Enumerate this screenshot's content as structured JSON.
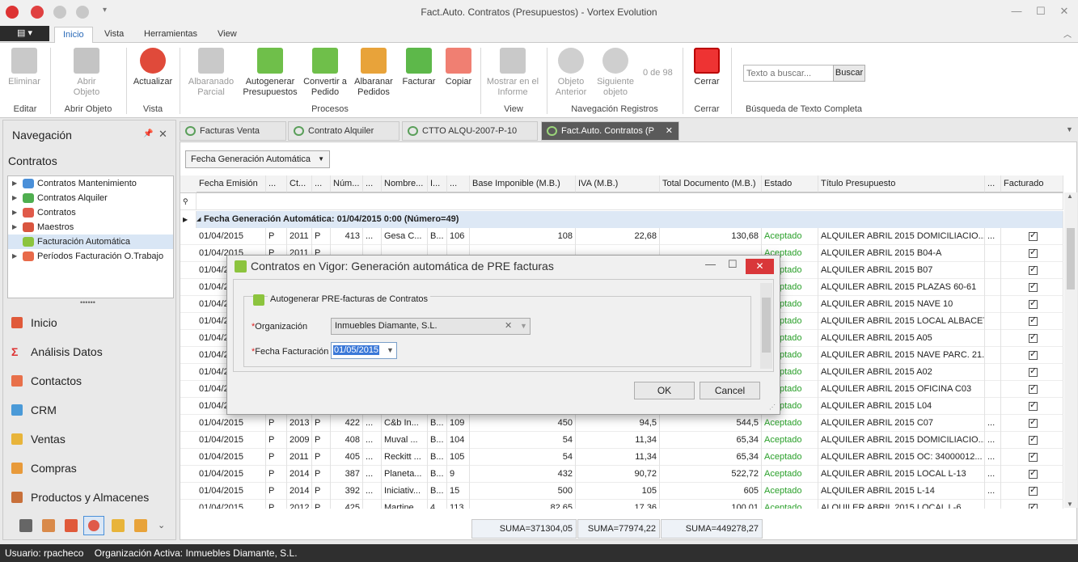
{
  "window": {
    "title": "Fact.Auto. Contratos (Presupuestos) - Vortex Evolution"
  },
  "ribbon_tabs": [
    "Inicio",
    "Vista",
    "Herramientas",
    "View"
  ],
  "ribbon": {
    "eliminar": "Eliminar",
    "abrir_objeto": "Abrir Objeto",
    "actualizar": "Actualizar",
    "albaranado_parcial": "Albaranado Parcial",
    "autogenerar": "Autogenerar Presupuestos",
    "convertir": "Convertir a Pedido",
    "albaranar": "Albaranar Pedidos",
    "facturar": "Facturar",
    "copiar": "Copiar",
    "mostrar": "Mostrar en el Informe",
    "anterior": "Objeto Anterior",
    "siguiente": "Siguiente objeto",
    "counter": "0 de 98",
    "cerrar": "Cerrar",
    "search_placeholder": "Texto a buscar...",
    "buscar": "Buscar",
    "groups": [
      "Editar",
      "Abrir Objeto",
      "Vista",
      "Procesos",
      "View",
      "Navegación Registros",
      "Cerrar",
      "Búsqueda de Texto Completa"
    ]
  },
  "navigation": {
    "title": "Navegación",
    "section": "Contratos",
    "tree": [
      "Contratos Mantenimiento",
      "Contratos Alquiler",
      "Contratos",
      "Maestros",
      "Facturación Automática",
      "Períodos Facturación O.Trabajo"
    ],
    "buttons": [
      "Inicio",
      "Análisis Datos",
      "Contactos",
      "CRM",
      "Ventas",
      "Compras",
      "Productos y Almacenes"
    ]
  },
  "doc_tabs": [
    "Facturas Venta",
    "Contrato Alquiler",
    "CTTO ALQU-2007-P-10",
    "Fact.Auto. Contratos (P"
  ],
  "grid": {
    "group_by": "Fecha Generación Automática",
    "columns": [
      "Fecha Emisión",
      "...",
      "Ct...",
      "...",
      "Núm...",
      "...",
      "Nombre...",
      "I...",
      "...",
      "Base Imponible (M.B.)",
      "IVA (M.B.)",
      "Total Documento (M.B.)",
      "Estado",
      "Título Presupuesto",
      "...",
      "Facturado"
    ],
    "group_row": "Fecha Generación Automática: 01/04/2015 0:00 (Número=49)",
    "rows": [
      [
        "01/04/2015",
        "P",
        "2011",
        "P",
        "413",
        "...",
        "Gesa C...",
        "B...",
        "106",
        "108",
        "22,68",
        "130,68",
        "Aceptado",
        "ALQUILER ABRIL 2015 DOMICILIACIO...",
        "..."
      ],
      [
        "01/04/2015",
        "P",
        "2011",
        "P",
        "",
        "",
        "",
        "",
        "",
        "",
        "",
        "",
        "Aceptado",
        "ALQUILER ABRIL 2015 B04-A",
        ""
      ],
      [
        "01/04/2015",
        "",
        "",
        "",
        "",
        "",
        "",
        "",
        "",
        "",
        "",
        "",
        "Aceptado",
        "ALQUILER ABRIL 2015 B07",
        ""
      ],
      [
        "01/04/2015",
        "",
        "",
        "",
        "",
        "",
        "",
        "",
        "",
        "",
        "",
        "",
        "Aceptado",
        "ALQUILER ABRIL 2015 PLAZAS 60-61",
        ""
      ],
      [
        "01/04/2015",
        "",
        "",
        "",
        "",
        "",
        "",
        "",
        "",
        "",
        "",
        "",
        "Aceptado",
        "ALQUILER ABRIL 2015 NAVE 10",
        ""
      ],
      [
        "01/04/2015",
        "",
        "",
        "",
        "",
        "",
        "",
        "",
        "",
        "",
        "",
        "",
        "Aceptado",
        "ALQUILER ABRIL 2015 LOCAL ALBACETE",
        ""
      ],
      [
        "01/04/2015",
        "",
        "",
        "",
        "",
        "",
        "",
        "",
        "",
        "",
        "",
        "",
        "Aceptado",
        "ALQUILER ABRIL 2015 A05",
        ""
      ],
      [
        "01/04/2015",
        "",
        "",
        "",
        "",
        "",
        "",
        "",
        "",
        "",
        "",
        "",
        "Aceptado",
        "ALQUILER ABRIL 2015 NAVE PARC. 21...",
        ""
      ],
      [
        "01/04/2015",
        "",
        "",
        "",
        "",
        "",
        "",
        "",
        "",
        "",
        "",
        "",
        "Aceptado",
        "ALQUILER ABRIL 2015 A02",
        ""
      ],
      [
        "01/04/2015",
        "",
        "",
        "",
        "",
        "",
        "",
        "",
        "",
        "",
        "",
        "",
        "Aceptado",
        "ALQUILER ABRIL 2015 OFICINA C03",
        ""
      ],
      [
        "01/04/2015",
        "",
        "",
        "",
        "",
        "",
        "",
        "",
        "",
        "",
        "",
        "",
        "Aceptado",
        "ALQUILER ABRIL 2015 L04",
        ""
      ],
      [
        "01/04/2015",
        "P",
        "2013",
        "P",
        "422",
        "...",
        "C&b In...",
        "B...",
        "109",
        "450",
        "94,5",
        "544,5",
        "Aceptado",
        "ALQUILER ABRIL 2015 C07",
        "..."
      ],
      [
        "01/04/2015",
        "P",
        "2009",
        "P",
        "408",
        "...",
        "Muval ...",
        "B...",
        "104",
        "54",
        "11,34",
        "65,34",
        "Aceptado",
        "ALQUILER ABRIL 2015 DOMICILIACIO...",
        "..."
      ],
      [
        "01/04/2015",
        "P",
        "2011",
        "P",
        "405",
        "...",
        "Reckitt ...",
        "B...",
        "105",
        "54",
        "11,34",
        "65,34",
        "Aceptado",
        "ALQUILER ABRIL 2015 OC: 34000012...",
        "..."
      ],
      [
        "01/04/2015",
        "P",
        "2014",
        "P",
        "387",
        "...",
        "Planeta...",
        "B...",
        "9",
        "432",
        "90,72",
        "522,72",
        "Aceptado",
        "ALQUILER ABRIL 2015 LOCAL L-13",
        "..."
      ],
      [
        "01/04/2015",
        "P",
        "2014",
        "P",
        "392",
        "...",
        "Iniciativ...",
        "B...",
        "15",
        "500",
        "105",
        "605",
        "Aceptado",
        "ALQUILER ABRIL 2015 L-14",
        "..."
      ],
      [
        "01/04/2015",
        "P",
        "2012",
        "P",
        "425",
        "...",
        "Martine...",
        "4...",
        "113",
        "82,65",
        "17,36",
        "100,01",
        "Aceptado",
        "ALQUILER ABRIL 2015 LOCAL L-6",
        "..."
      ]
    ],
    "totals": [
      "SUMA=371304,05",
      "SUMA=77974,22",
      "SUMA=449278,27"
    ]
  },
  "dialog": {
    "title": "Contratos en Vigor: Generación automática de PRE facturas",
    "group": "Autogenerar PRE-facturas de Contratos",
    "org_label": "Organización",
    "org_value": "Inmuebles Diamante, S.L.",
    "fecha_label": "Fecha Facturación",
    "fecha_value": "01/05/2015",
    "ok": "OK",
    "cancel": "Cancel"
  },
  "status": {
    "user": "Usuario: rpacheco",
    "org": "Organización Activa: Inmuebles Diamante, S.L."
  }
}
